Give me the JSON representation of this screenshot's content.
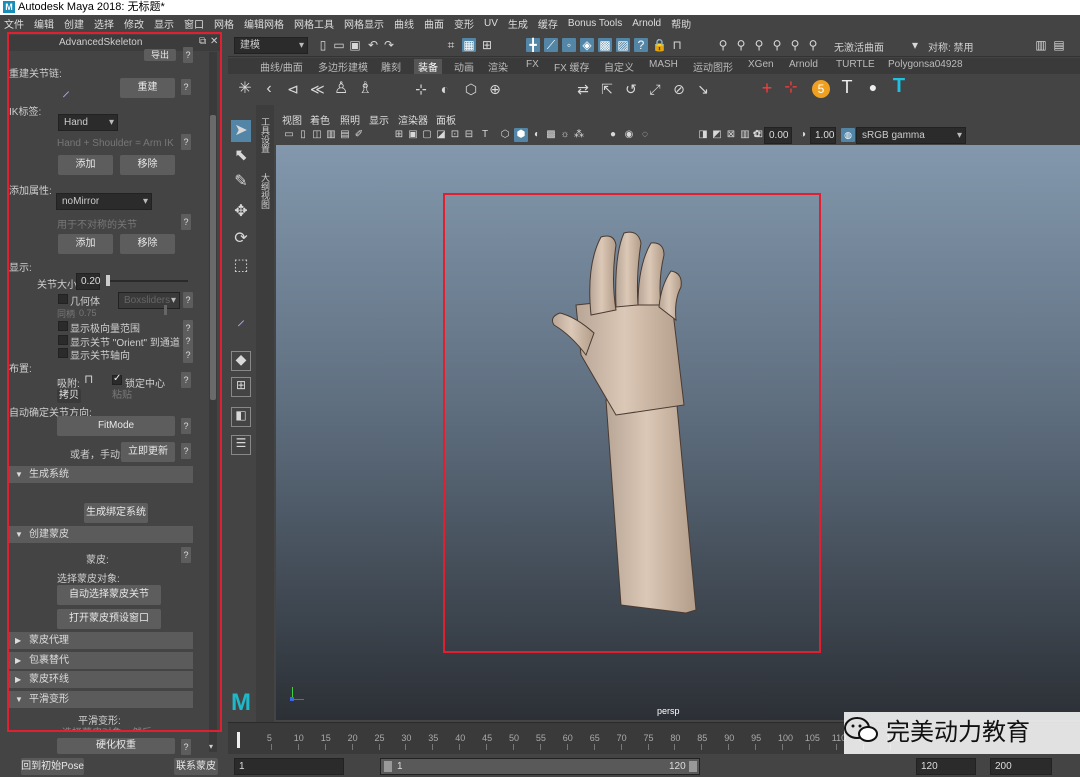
{
  "window": {
    "title": "Autodesk Maya 2018: 无标题*"
  },
  "menu": [
    "文件",
    "编辑",
    "创建",
    "选择",
    "修改",
    "显示",
    "窗口",
    "网格",
    "编辑网格",
    "网格工具",
    "网格显示",
    "曲线",
    "曲面",
    "变形",
    "UV",
    "生成",
    "缓存",
    "Bonus Tools",
    "Arnold",
    "帮助"
  ],
  "statusline": {
    "mode": "建模",
    "live_surface": "无激活曲面",
    "symmetry": "对称: 禁用"
  },
  "shelf_tabs": [
    "曲线/曲面",
    "多边形建模",
    "雕刻",
    "装备",
    "动画",
    "渲染",
    "FX",
    "FX 缓存",
    "自定义",
    "MASH",
    "运动图形",
    "XGen",
    "Arnold",
    "TURTLE",
    "Polygonsa04928"
  ],
  "shelf_active_tab": "装备",
  "panel": {
    "title": "AdvancedSkeleton",
    "export_btn": "导出",
    "rebuild_joints_label": "重建关节链:",
    "rebuild_btn": "重建",
    "ik_label": "IK标签:",
    "ik_value": "Hand",
    "ik_desc": "Hand + Shoulder = Arm IK",
    "add_btn": "添加",
    "remove_btn": "移除",
    "add_attr_label": "添加属性:",
    "mirror_value": "noMirror",
    "mirror_desc": "用于不对称的关节",
    "add_btn2": "添加",
    "remove_btn2": "移除",
    "display_label": "显示:",
    "joint_size_label": "关节大小",
    "joint_size_value": "0.20",
    "geometry_label": "几何体",
    "geometry_dropdown": "Boxsliders",
    "geo_small_label": "同柄",
    "geo_small_value": "0.75",
    "show_pole_label": "显示极向量范围",
    "show_orient_label": "显示关节 \"Orient\" 到通道盒",
    "show_axis_label": "显示关节轴向",
    "layout_label": "布置:",
    "snap_label": "吸附:",
    "lock_center_label": "锁定中心",
    "copy_btn": "拷贝",
    "paste_btn": "粘贴",
    "auto_orient_label": "自动确定关节方向:",
    "fitmode_btn": "FitMode",
    "or_manual_label": "或者，手动:",
    "update_now_btn": "立即更新",
    "build_system_section": "生成系统",
    "build_rig_btn": "生成绑定系统",
    "create_skin_section": "创建蒙皮",
    "skin_label": "蒙皮:",
    "select_skin_obj_label": "选择蒙皮对象:",
    "auto_select_joints_btn": "自动选择蒙皮关节",
    "open_skin_preset_btn": "打开蒙皮预设窗口",
    "skin_proxy_section": "蒙皮代理",
    "wrap_section": "包裹替代",
    "skin_cage_section": "蒙皮环线",
    "smooth_deform_section": "平滑变形",
    "smooth_deform_label": "平滑变形:",
    "smooth_deform_sub": "选择蒙皮对象，然后",
    "harden_weights_btn": "硬化权重",
    "goto_bind_pose_btn": "回到初始Pose",
    "detach_skin_btn": "联系蒙皮"
  },
  "viewport": {
    "menu": [
      "视图",
      "着色",
      "照明",
      "显示",
      "渲染器",
      "面板"
    ],
    "value_a": "0.00",
    "value_b": "1.00",
    "colorspace": "sRGB gamma",
    "camera": "persp"
  },
  "timeline": {
    "ticks": [
      "5",
      "10",
      "15",
      "20",
      "25",
      "30",
      "35",
      "40",
      "45",
      "50",
      "55",
      "60",
      "65",
      "70",
      "75",
      "80",
      "85",
      "90",
      "95",
      "100",
      "105",
      "110",
      "115",
      "120"
    ],
    "start": "1",
    "range_start": "1",
    "range_current": "1",
    "range_end_inner": "120",
    "range_end": "120",
    "anim_end": "200"
  },
  "watermark": "完美动力教育"
}
